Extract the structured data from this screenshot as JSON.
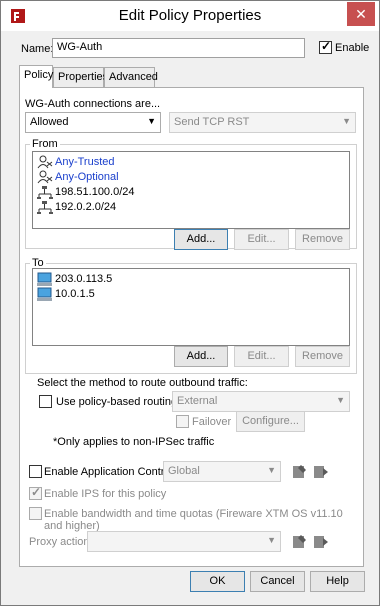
{
  "window": {
    "title": "Edit Policy Properties",
    "close_glyph": "✕"
  },
  "name_row": {
    "label": "Name:",
    "value": "WG-Auth",
    "enable_label": "Enable",
    "enable_checked": true
  },
  "tabs": [
    {
      "label": "Policy",
      "active": true
    },
    {
      "label": "Properties",
      "active": false
    },
    {
      "label": "Advanced",
      "active": false
    }
  ],
  "connections": {
    "label": "WG-Auth connections are...",
    "action": "Allowed",
    "reject_action": "Send TCP RST"
  },
  "from": {
    "label": "From",
    "items": [
      {
        "label": "Any-Trusted",
        "icon": "alias-icon",
        "link": true
      },
      {
        "label": "Any-Optional",
        "icon": "alias-icon",
        "link": true
      },
      {
        "label": "198.51.100.0/24",
        "icon": "network-icon",
        "link": false
      },
      {
        "label": "192.0.2.0/24",
        "icon": "network-icon",
        "link": false
      }
    ],
    "buttons": {
      "add": "Add...",
      "edit": "Edit...",
      "remove": "Remove"
    }
  },
  "to": {
    "label": "To",
    "items": [
      {
        "label": "203.0.113.5",
        "icon": "host-icon"
      },
      {
        "label": "10.0.1.5",
        "icon": "host-icon"
      }
    ],
    "buttons": {
      "add": "Add...",
      "edit": "Edit...",
      "remove": "Remove"
    }
  },
  "routing": {
    "label": "Select the method to route outbound traffic:",
    "use_pbr_label": "Use policy-based routing",
    "interface": "External",
    "failover_label": "Failover",
    "configure_label": "Configure...",
    "note": "*Only applies to non-IPSec traffic"
  },
  "app_control": {
    "label": "Enable Application Control:",
    "value": "Global"
  },
  "ips": {
    "label": "Enable IPS for this policy",
    "checked": true
  },
  "bandwidth": {
    "label": "Enable bandwidth and time quotas (Fireware XTM OS v11.10 and higher)"
  },
  "proxy": {
    "label": "Proxy action:",
    "value": ""
  },
  "footer": {
    "ok": "OK",
    "cancel": "Cancel",
    "help": "Help"
  }
}
